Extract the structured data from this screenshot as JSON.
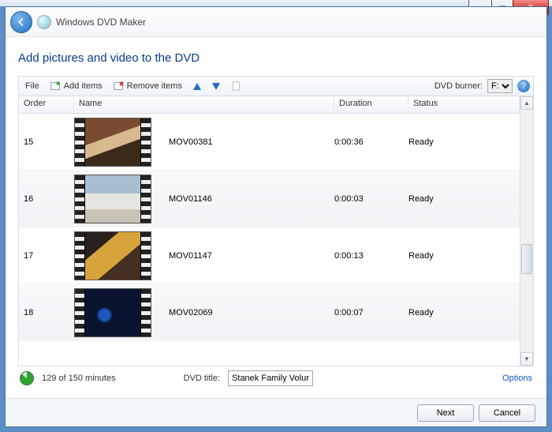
{
  "app": {
    "title": "Windows DVD Maker"
  },
  "page": {
    "heading": "Add pictures and video to the DVD"
  },
  "toolbar": {
    "file": "File",
    "add": "Add items",
    "remove": "Remove items",
    "burner_label": "DVD burner:",
    "burner_value": "F:"
  },
  "columns": {
    "order": "Order",
    "name": "Name",
    "duration": "Duration",
    "status": "Status"
  },
  "rows": [
    {
      "order": "15",
      "name": "MOV00381",
      "duration": "0:00:36",
      "status": "Ready",
      "thumb": "f1"
    },
    {
      "order": "16",
      "name": "MOV01146",
      "duration": "0:00:03",
      "status": "Ready",
      "thumb": "f2"
    },
    {
      "order": "17",
      "name": "MOV01147",
      "duration": "0:00:13",
      "status": "Ready",
      "thumb": "f3"
    },
    {
      "order": "18",
      "name": "MOV02069",
      "duration": "0:00:07",
      "status": "Ready",
      "thumb": "f4"
    }
  ],
  "footer": {
    "minutes": "129 of 150 minutes",
    "title_label": "DVD title:",
    "title_value": "Stanek Family Volum",
    "options": "Options"
  },
  "buttons": {
    "next": "Next",
    "cancel": "Cancel"
  }
}
